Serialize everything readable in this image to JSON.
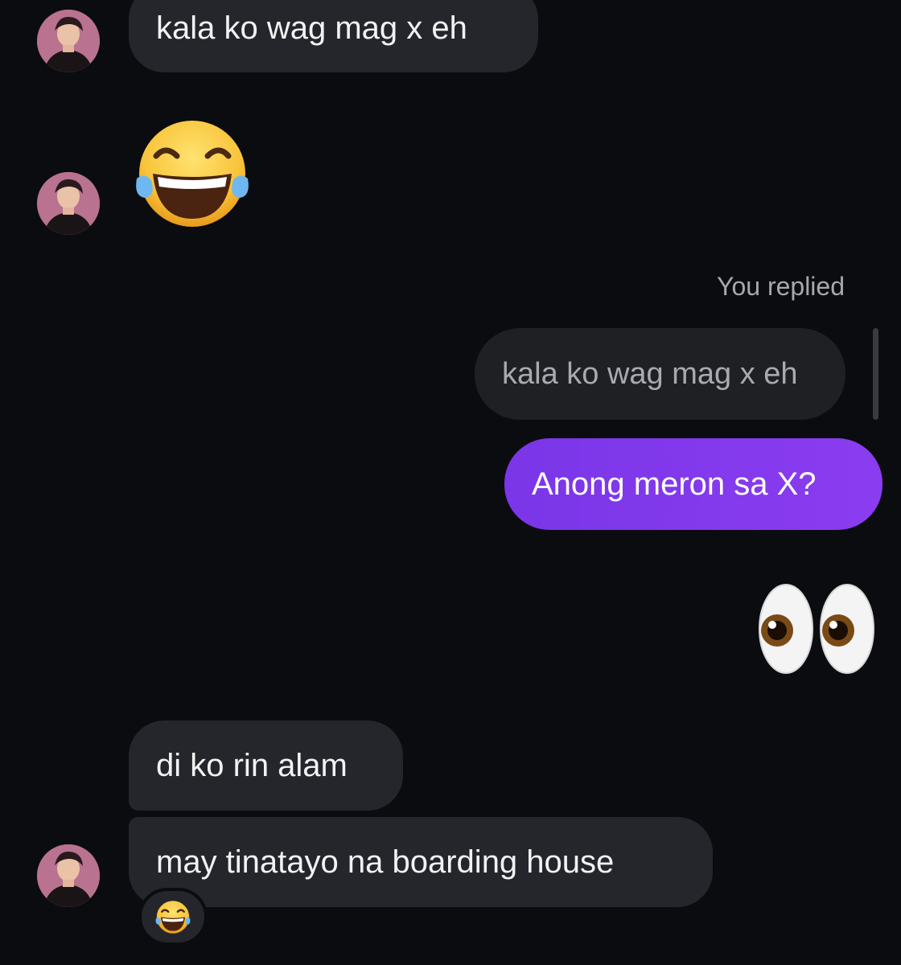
{
  "conversation": {
    "messages": [
      {
        "from": "them",
        "text": "kala ko wag mag x eh"
      },
      {
        "from": "them",
        "emoji": "face-with-tears-of-joy"
      },
      {
        "from": "me",
        "replied_label": "You replied",
        "quoted_text": "kala ko wag mag x eh",
        "text": "Anong meron sa X?"
      },
      {
        "from": "me",
        "emoji": "eyes"
      },
      {
        "from": "them",
        "text": "di ko rin alam"
      },
      {
        "from": "them",
        "text": "may tinatayo na boarding house",
        "reaction": "face-with-tears-of-joy"
      }
    ]
  },
  "colors": {
    "background": "#0b0c10",
    "incoming_bubble": "#25262b",
    "outgoing_bubble": "#7b35e6",
    "quoted_bubble": "#1f2024"
  }
}
